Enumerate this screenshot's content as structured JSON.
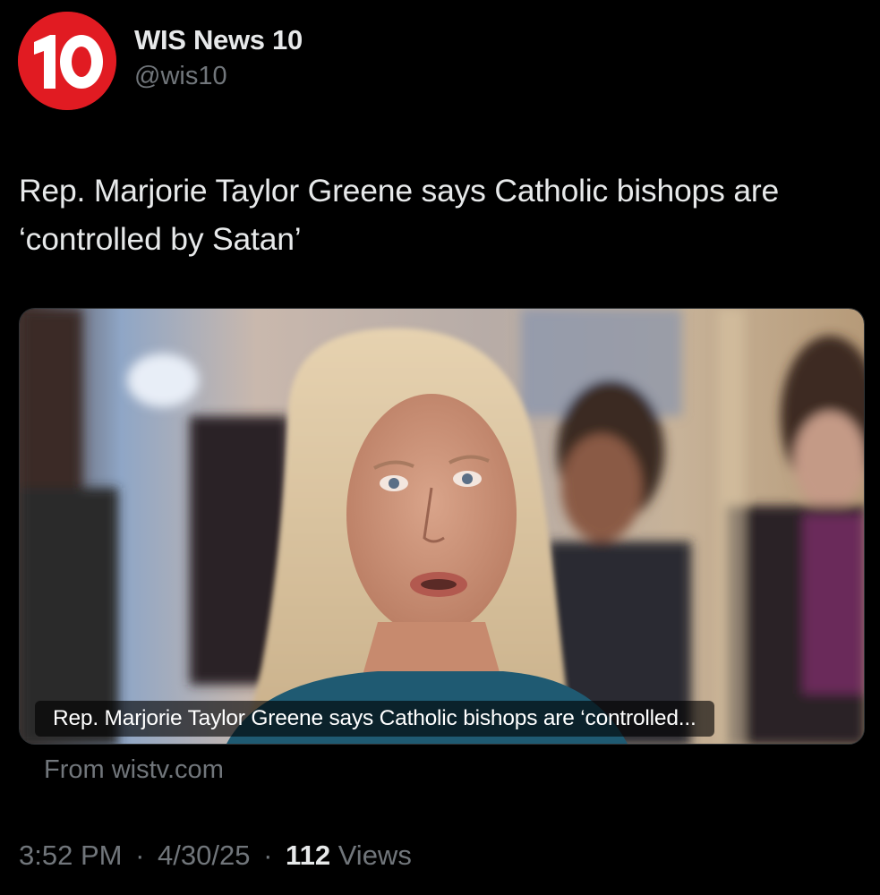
{
  "account": {
    "display_name": "WIS News 10",
    "handle": "@wis10",
    "avatar_logo_text": "10"
  },
  "tweet": {
    "text": "Rep. Marjorie Taylor Greene says Catholic bishops are ‘controlled by Satan’"
  },
  "link_card": {
    "caption": "Rep. Marjorie Taylor Greene says Catholic bishops are ‘controlled...",
    "source": "From wistv.com"
  },
  "meta": {
    "time": "3:52 PM",
    "separator": "·",
    "date": "4/30/25",
    "views_count": "112",
    "views_label": "Views"
  },
  "colors": {
    "background": "#000000",
    "text_primary": "#e7e9ea",
    "text_secondary": "#71767b",
    "brand_red": "#e11b22"
  }
}
